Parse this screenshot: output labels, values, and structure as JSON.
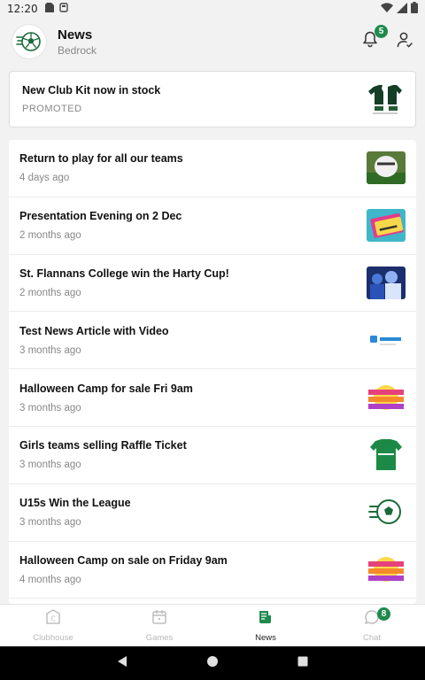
{
  "status_bar": {
    "time": "12:20"
  },
  "header": {
    "title": "News",
    "subtitle": "Bedrock",
    "notification_count": "5"
  },
  "promo": {
    "title": "New Club Kit now in stock",
    "label": "PROMOTED"
  },
  "news": [
    {
      "title": "Return to play for all our teams",
      "meta": "4 days ago"
    },
    {
      "title": "Presentation Evening on 2 Dec",
      "meta": "2 months ago"
    },
    {
      "title": "St. Flannans College win the Harty Cup!",
      "meta": "2 months ago"
    },
    {
      "title": "Test News Article with Video",
      "meta": "3 months ago"
    },
    {
      "title": "Halloween Camp for sale Fri 9am",
      "meta": "3 months ago"
    },
    {
      "title": "Girls teams selling Raffle Ticket",
      "meta": "3 months ago"
    },
    {
      "title": "U15s Win the League",
      "meta": "3 months ago"
    },
    {
      "title": "Halloween Camp on sale on Friday 9am",
      "meta": "4 months ago"
    }
  ],
  "bottom_nav": {
    "items": [
      {
        "label": "Clubhouse"
      },
      {
        "label": "Games"
      },
      {
        "label": "News"
      },
      {
        "label": "Chat"
      }
    ],
    "chat_badge": "8",
    "active": "News"
  },
  "colors": {
    "accent": "#1f8a4c",
    "background": "#f2f2f2"
  },
  "icons": [
    "sim-icon",
    "storage-icon",
    "wifi-icon",
    "signal-icon",
    "battery-icon",
    "club-logo",
    "bell-icon",
    "profile-icon",
    "clubhouse-icon",
    "games-icon",
    "news-icon",
    "chat-icon",
    "back-icon",
    "home-icon",
    "recents-icon"
  ]
}
